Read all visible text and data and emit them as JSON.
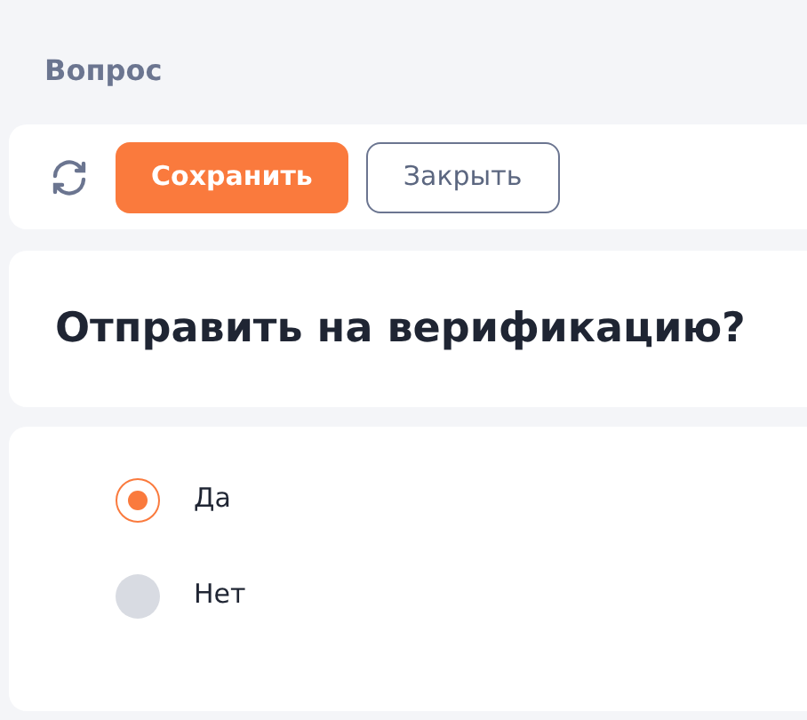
{
  "page_title": "Вопрос",
  "toolbar": {
    "buttons": [
      {
        "kind": "primary",
        "label": "Сохранить"
      },
      {
        "kind": "outline",
        "label": "Закрыть"
      }
    ]
  },
  "question": "Отправить на верификацию?",
  "options": [
    {
      "label": "Да",
      "selected": true
    },
    {
      "label": "Нет",
      "selected": false
    }
  ]
}
